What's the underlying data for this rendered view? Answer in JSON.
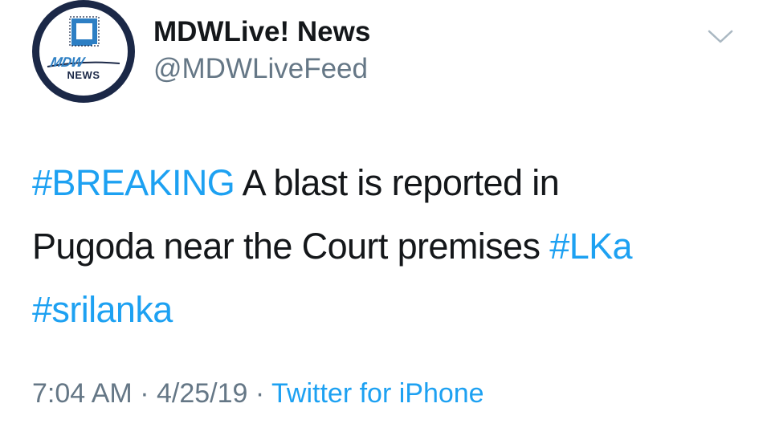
{
  "account": {
    "display_name": "MDWLive! News",
    "handle": "@MDWLiveFeed",
    "avatar": {
      "logo_text": "MDW",
      "sub_text": "NEWS",
      "ring_color": "#1b2847",
      "accent_color": "#2d7fc4"
    }
  },
  "menu": {
    "icon": "chevron-down-icon"
  },
  "tweet": {
    "line1": {
      "hashtag": "#BREAKING",
      "text": " A blast is reported in"
    },
    "line2": {
      "text": "Pugoda near the Court premises ",
      "hashtag": "#LKa"
    },
    "line3": {
      "hashtag": "#srilanka"
    }
  },
  "meta": {
    "time": "7:04 AM",
    "separator1": " · ",
    "date": "4/25/19",
    "separator2": " · ",
    "source": "Twitter for iPhone"
  },
  "colors": {
    "link": "#1da1f2",
    "text": "#14171a",
    "secondary": "#657786"
  }
}
